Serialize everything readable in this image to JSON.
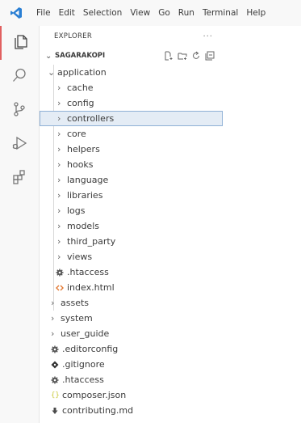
{
  "menu": [
    "File",
    "Edit",
    "Selection",
    "View",
    "Go",
    "Run",
    "Terminal",
    "Help"
  ],
  "explorer": {
    "title": "EXPLORER",
    "more": "···",
    "root": "SAGARAKOPI",
    "tree": [
      {
        "label": "application",
        "expanded": true
      },
      {
        "label": "cache"
      },
      {
        "label": "config"
      },
      {
        "label": "controllers",
        "selected": true
      },
      {
        "label": "core"
      },
      {
        "label": "helpers"
      },
      {
        "label": "hooks"
      },
      {
        "label": "language"
      },
      {
        "label": "libraries"
      },
      {
        "label": "logs"
      },
      {
        "label": "models"
      },
      {
        "label": "third_party"
      },
      {
        "label": "views"
      },
      {
        "label": ".htaccess",
        "icon": "gear-icon"
      },
      {
        "label": "index.html",
        "icon": "html-icon"
      },
      {
        "label": "assets"
      },
      {
        "label": "system"
      },
      {
        "label": "user_guide"
      },
      {
        "label": ".editorconfig",
        "icon": "gear-icon"
      },
      {
        "label": ".gitignore",
        "icon": "git-icon"
      },
      {
        "label": ".htaccess",
        "icon": "gear-icon"
      },
      {
        "label": "composer.json",
        "icon": "json-icon"
      },
      {
        "label": "contributing.md",
        "icon": "markdown-icon"
      }
    ]
  },
  "colors": {
    "accent_active": "#e16060",
    "selection_bg": "#e4ecf5",
    "selection_border": "#8fb0d6",
    "vscode_blue": "#2a7fd4",
    "html_icon": "#e37933",
    "json_icon": "#cbcb41"
  }
}
